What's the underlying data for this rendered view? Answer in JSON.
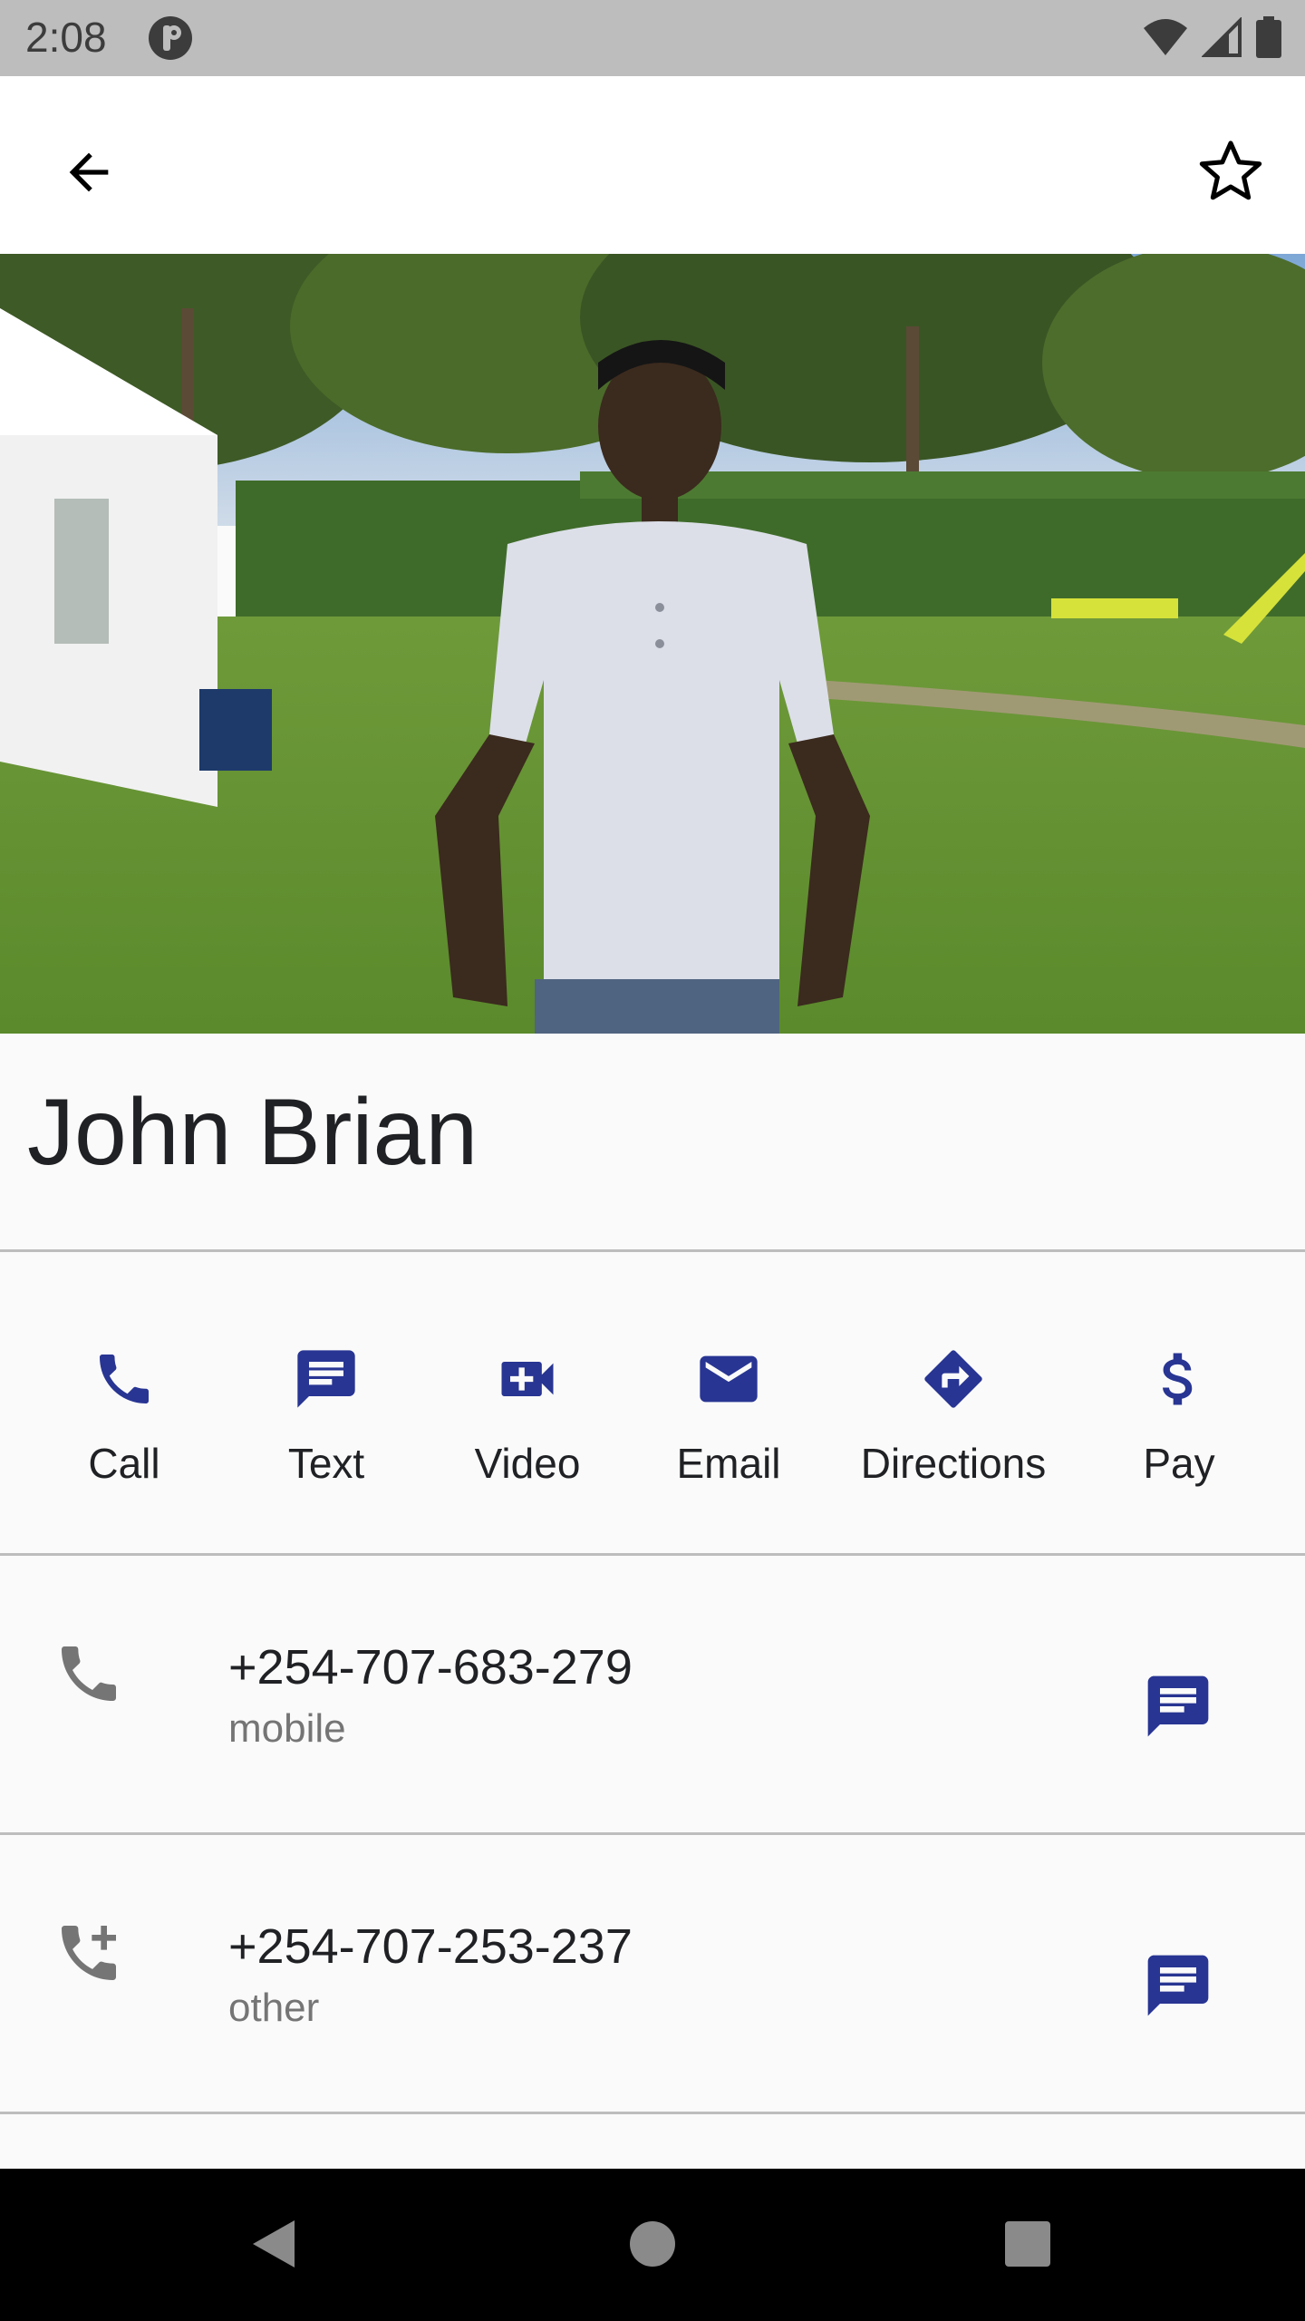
{
  "status_bar": {
    "time": "2:08"
  },
  "contact": {
    "name": "John Brian"
  },
  "actions": [
    {
      "label": "Call",
      "icon": "phone-icon"
    },
    {
      "label": "Text",
      "icon": "message-icon"
    },
    {
      "label": "Video",
      "icon": "video-icon"
    },
    {
      "label": "Email",
      "icon": "email-icon"
    },
    {
      "label": "Directions",
      "icon": "directions-icon"
    },
    {
      "label": "Pay",
      "icon": "dollar-icon"
    }
  ],
  "phones": [
    {
      "number": "+254-707-683-279",
      "type": "mobile",
      "icon": "phone-icon"
    },
    {
      "number": "+254-707-253-237",
      "type": "other",
      "icon": "add-call-icon"
    }
  ],
  "colors": {
    "accent": "#283593",
    "secondary_text": "#757575",
    "divider": "#bdbdbd"
  }
}
